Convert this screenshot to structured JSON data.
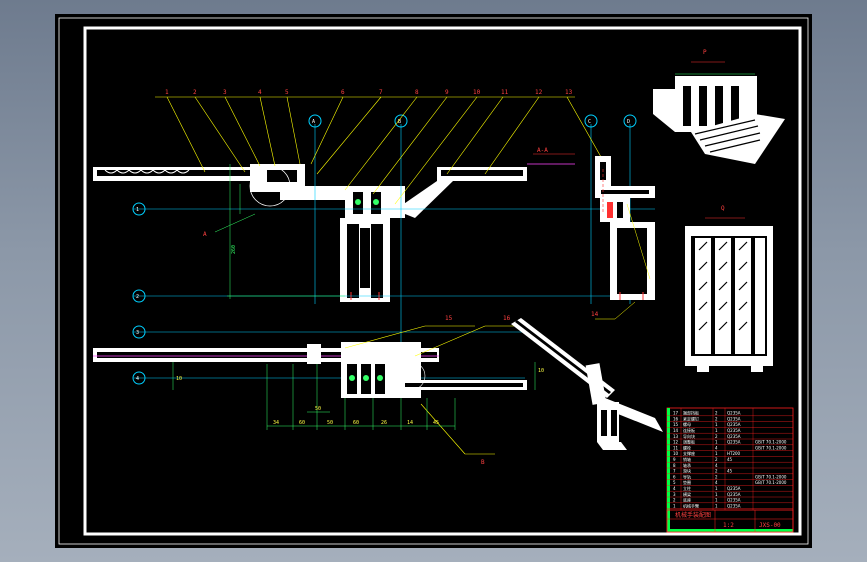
{
  "colors": {
    "background": "#000000",
    "frame": "#ffffff",
    "leader": "#ffff00",
    "dimension": "#33ff66",
    "centerline": "#00d0ff",
    "section": "#ff3030",
    "purple": "#ff44ff"
  },
  "balloons": [
    "1",
    "2",
    "3",
    "4",
    "5",
    "6",
    "7",
    "8",
    "9",
    "10",
    "11",
    "12",
    "13"
  ],
  "lower_balloons": [
    "15",
    "16"
  ],
  "side_balloon": "14",
  "axis_markers": [
    "A",
    "B",
    "C",
    "D"
  ],
  "axis_markers_left": [
    "1",
    "2",
    "3",
    "4"
  ],
  "view_labels": [
    "P",
    "Q"
  ],
  "dims_lower": [
    "34",
    "60",
    "50",
    "60",
    "26",
    "14",
    "45",
    "50",
    "10",
    "10"
  ],
  "bom_rows": [
    {
      "no": "17",
      "name": "端部挡板",
      "qty": "2",
      "mat": "Q235A",
      "std": ""
    },
    {
      "no": "16",
      "name": "紧定螺钉",
      "qty": "2",
      "mat": "Q235A",
      "std": ""
    },
    {
      "no": "15",
      "name": "螺母",
      "qty": "1",
      "mat": "Q235A",
      "std": ""
    },
    {
      "no": "14",
      "name": "连接板",
      "qty": "1",
      "mat": "Q235A",
      "std": ""
    },
    {
      "no": "13",
      "name": "导向块",
      "qty": "2",
      "mat": "Q235A",
      "std": ""
    },
    {
      "no": "12",
      "name": "调整板",
      "qty": "1",
      "mat": "Q235A",
      "std": "GB/T 70.1-2000"
    },
    {
      "no": "11",
      "name": "螺栓",
      "qty": "4",
      "mat": "",
      "std": "GB/T 70.1-2000"
    },
    {
      "no": "10",
      "name": "支撑座",
      "qty": "1",
      "mat": "HT200",
      "std": ""
    },
    {
      "no": "9",
      "name": "销轴",
      "qty": "2",
      "mat": "45",
      "std": ""
    },
    {
      "no": "8",
      "name": "轴承",
      "qty": "4",
      "mat": "",
      "std": ""
    },
    {
      "no": "7",
      "name": "滑块",
      "qty": "2",
      "mat": "45",
      "std": ""
    },
    {
      "no": "6",
      "name": "导轨",
      "qty": "2",
      "mat": "",
      "std": "GB/T 70.1-2000"
    },
    {
      "no": "5",
      "name": "垫圈",
      "qty": "4",
      "mat": "",
      "std": "GB/T 70.1-2000"
    },
    {
      "no": "4",
      "name": "立柱",
      "qty": "1",
      "mat": "Q235A",
      "std": ""
    },
    {
      "no": "3",
      "name": "横梁",
      "qty": "1",
      "mat": "Q235A",
      "std": ""
    },
    {
      "no": "2",
      "name": "底座",
      "qty": "1",
      "mat": "Q235A",
      "std": ""
    },
    {
      "no": "1",
      "name": "机械手臂",
      "qty": "1",
      "mat": "Q235A",
      "std": ""
    }
  ],
  "title_block": {
    "name": "机械手装配图",
    "scale": "1:2",
    "drawing_no": "JXS-00"
  }
}
